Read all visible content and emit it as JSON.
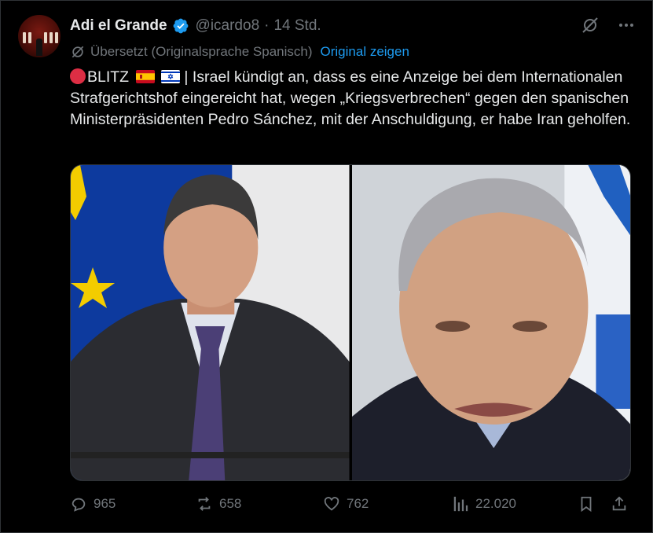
{
  "tweet": {
    "author_name": "Adi el Grande",
    "handle": "@icardo8",
    "separator": "·",
    "time": "14 Std.",
    "translated_note": "Übersetzt (Originalsprache Spanisch)",
    "show_original": "Original zeigen",
    "text_prefix": "BLITZ",
    "text_body": " | Israel kündigt an, dass es eine Anzeige bei dem Internationalen Strafgerichtshof eingereicht hat, wegen „Kriegsverbrechen“ gegen den spanischen Ministerpräsidenten Pedro Sánchez, mit der Anschuldigung, er habe Iran geholfen."
  },
  "metrics": {
    "replies": "965",
    "reposts": "658",
    "likes": "762",
    "views": "22.020"
  },
  "colors": {
    "background": "#000000",
    "text": "#e7e9ea",
    "muted": "#71767b",
    "accent": "#1d9bf0",
    "red": "#dd2e44"
  },
  "icons": [
    "verified-badge-icon",
    "grok-icon",
    "more-icon",
    "translate-icon",
    "reply-icon",
    "repost-icon",
    "like-icon",
    "views-icon",
    "bookmark-icon",
    "share-icon",
    "red-circle-emoji",
    "spain-flag-emoji",
    "israel-flag-emoji"
  ]
}
